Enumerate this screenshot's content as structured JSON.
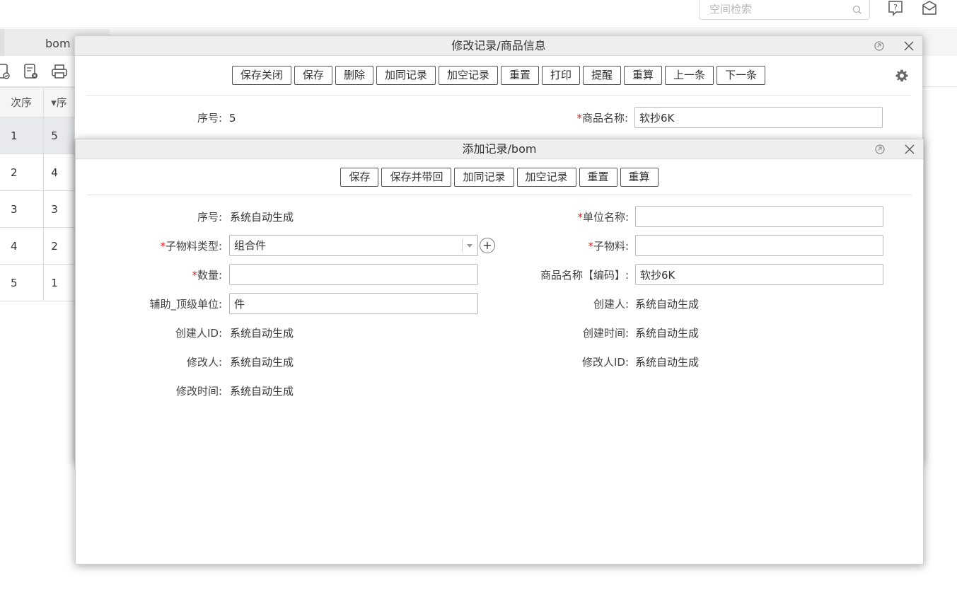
{
  "topbar": {
    "search_placeholder": "空间检索",
    "icons": [
      "search-icon",
      "help-icon",
      "message-icon"
    ]
  },
  "background": {
    "tab_label": "bom",
    "table": {
      "headers": [
        "次序",
        "▾序"
      ],
      "rows": [
        {
          "order": "1",
          "seq": "5"
        },
        {
          "order": "2",
          "seq": "4"
        },
        {
          "order": "3",
          "seq": "3"
        },
        {
          "order": "4",
          "seq": "2"
        },
        {
          "order": "5",
          "seq": "1"
        }
      ]
    }
  },
  "edit_window": {
    "title": "修改记录/商品信息",
    "buttons": [
      "保存关闭",
      "保存",
      "删除",
      "加同记录",
      "加空记录",
      "重置",
      "打印",
      "提醒",
      "重算",
      "上一条",
      "下一条"
    ],
    "fields": {
      "seq_label": "序号:",
      "seq_value": "5",
      "product_name_label": "商品名称:",
      "product_name_value": "软抄6K"
    }
  },
  "add_window": {
    "title": "添加记录/bom",
    "buttons": [
      "保存",
      "保存并带回",
      "加同记录",
      "加空记录",
      "重置",
      "重算"
    ],
    "fields": {
      "seq_label": "序号:",
      "seq_value": "系统自动生成",
      "unit_name_label": "单位名称:",
      "unit_name_value": "",
      "sub_type_label": "子物料类型:",
      "sub_type_value": "组合件",
      "sub_material_label": "子物料:",
      "sub_material_value": "",
      "qty_label": "数量:",
      "qty_value": "",
      "product_code_label": "商品名称【编码】:",
      "product_code_value": "软抄6K",
      "top_unit_label": "辅助_顶级单位:",
      "top_unit_value": "件",
      "creator_label": "创建人:",
      "creator_value": "系统自动生成",
      "creator_id_label": "创建人ID:",
      "creator_id_value": "系统自动生成",
      "created_time_label": "创建时间:",
      "created_time_value": "系统自动生成",
      "modifier_label": "修改人:",
      "modifier_value": "系统自动生成",
      "modifier_id_label": "修改人ID:",
      "modifier_id_value": "系统自动生成",
      "modified_time_label": "修改时间:",
      "modified_time_value": "系统自动生成"
    }
  },
  "colors": {
    "required_mark": "#e02020",
    "title_bar": "#eeeeee",
    "selected_row": "#e8e9ed"
  }
}
